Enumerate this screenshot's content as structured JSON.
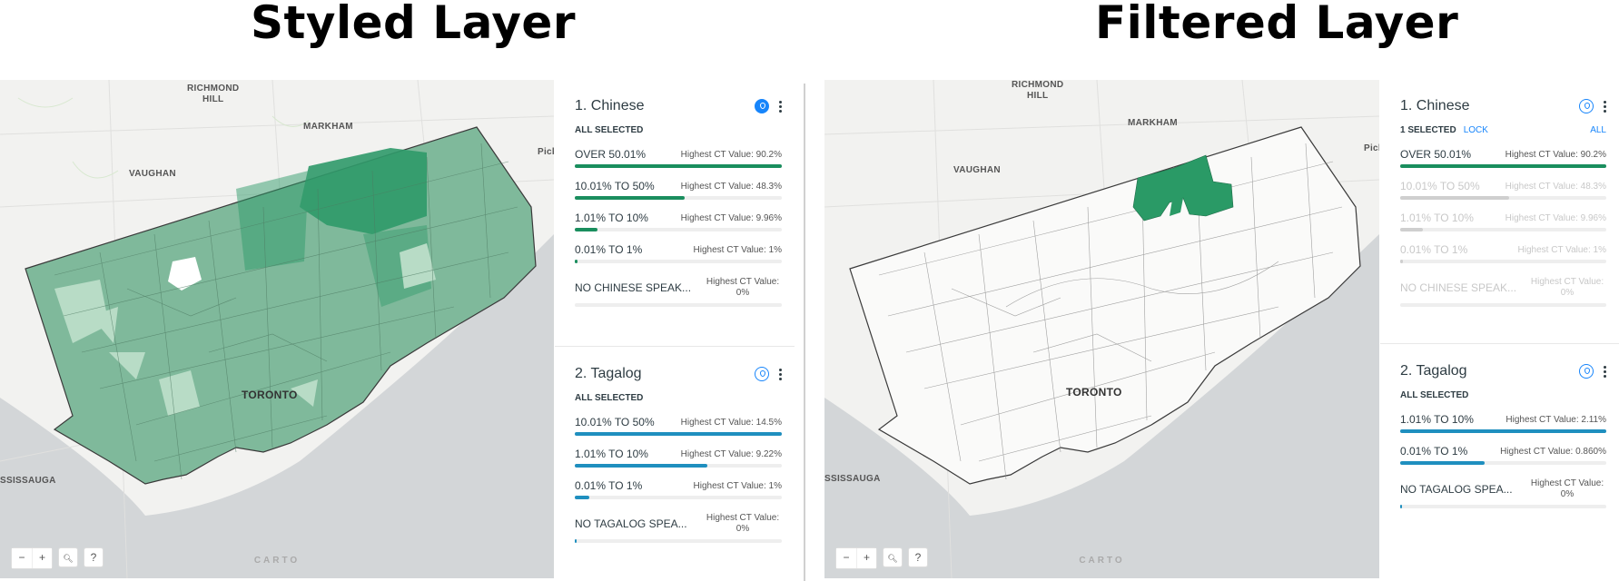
{
  "titles": {
    "left": "Styled Layer",
    "right": "Filtered Layer"
  },
  "map": {
    "places": {
      "richmond_hill": "RICHMOND\nHILL",
      "markham": "MARKHAM",
      "vaughan": "VAUGHAN",
      "toronto": "TORONTO",
      "mississauga": "SSISSAUGA",
      "pickering": "Pick"
    },
    "controls": {
      "zoom_out": "−",
      "zoom_in": "+",
      "search": "🔍",
      "help": "?"
    },
    "attribution": "CARTO"
  },
  "left_panel": {
    "widgets": [
      {
        "title": "1. Chinese",
        "status": "ALL SELECTED",
        "color": "#1a8e5e",
        "categories": [
          {
            "name": "OVER 50.01%",
            "value": "Highest CT Value: 90.2%",
            "fraction": 1.0
          },
          {
            "name": "10.01% TO 50%",
            "value": "Highest CT Value: 48.3%",
            "fraction": 0.53
          },
          {
            "name": "1.01% TO 10%",
            "value": "Highest CT Value: 9.96%",
            "fraction": 0.11
          },
          {
            "name": "0.01% TO 1%",
            "value": "Highest CT Value: 1%",
            "fraction": 0.012
          },
          {
            "name": "NO CHINESE SPEAK...",
            "value": "Highest CT Value: 0%",
            "fraction": 0.0
          }
        ]
      },
      {
        "title": "2. Tagalog",
        "status": "ALL SELECTED",
        "color": "#1f8fbf",
        "categories": [
          {
            "name": "10.01% TO 50%",
            "value": "Highest CT Value: 14.5%",
            "fraction": 1.0
          },
          {
            "name": "1.01% TO 10%",
            "value": "Highest CT Value: 9.22%",
            "fraction": 0.64
          },
          {
            "name": "0.01% TO 1%",
            "value": "Highest CT Value: 1%",
            "fraction": 0.07
          },
          {
            "name": "NO TAGALOG SPEA...",
            "value": "Highest CT Value: 0%",
            "fraction": 0.01
          }
        ]
      }
    ]
  },
  "right_panel": {
    "widgets": [
      {
        "title": "1. Chinese",
        "status": "1 SELECTED",
        "lock": "LOCK",
        "all": "ALL",
        "color": "#1a8e5e",
        "categories": [
          {
            "name": "OVER 50.01%",
            "value": "Highest CT Value: 90.2%",
            "fraction": 1.0,
            "dim": false
          },
          {
            "name": "10.01% TO 50%",
            "value": "Highest CT Value: 48.3%",
            "fraction": 0.53,
            "dim": true
          },
          {
            "name": "1.01% TO 10%",
            "value": "Highest CT Value: 9.96%",
            "fraction": 0.11,
            "dim": true
          },
          {
            "name": "0.01% TO 1%",
            "value": "Highest CT Value: 1%",
            "fraction": 0.012,
            "dim": true
          },
          {
            "name": "NO CHINESE SPEAK...",
            "value": "Highest CT Value: 0%",
            "fraction": 0.0,
            "dim": true
          }
        ]
      },
      {
        "title": "2. Tagalog",
        "status": "ALL SELECTED",
        "color": "#1f8fbf",
        "categories": [
          {
            "name": "1.01% TO 10%",
            "value": "Highest CT Value: 2.11%",
            "fraction": 1.0
          },
          {
            "name": "0.01% TO 1%",
            "value": "Highest CT Value: 0.860%",
            "fraction": 0.41
          },
          {
            "name": "NO TAGALOG SPEA...",
            "value": "Highest CT Value: 0%",
            "fraction": 0.01
          }
        ]
      }
    ]
  }
}
